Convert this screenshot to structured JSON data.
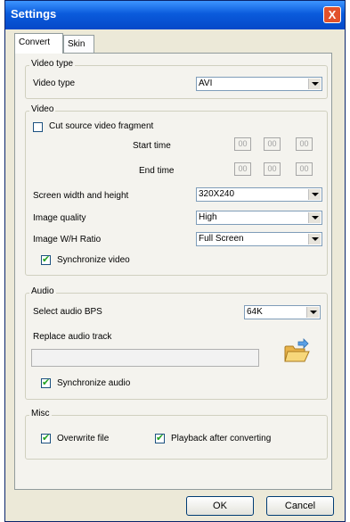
{
  "window": {
    "title": "Settings",
    "close": "X"
  },
  "tabs": [
    {
      "label": "Convert"
    },
    {
      "label": "Skin"
    }
  ],
  "video_type": {
    "group_label": "Video type",
    "label": "Video type",
    "value": "AVI"
  },
  "video": {
    "group_label": "Video",
    "cut_fragment_label": "Cut source video fragment",
    "cut_fragment_checked": false,
    "start_time_label": "Start time",
    "end_time_label": "End time",
    "start_time": [
      "00",
      "00",
      "00"
    ],
    "end_time": [
      "00",
      "00",
      "00"
    ],
    "screen_size_label": "Screen width and height",
    "screen_size_value": "320X240",
    "quality_label": "Image quality",
    "quality_value": "High",
    "ratio_label": "Image W/H Ratio",
    "ratio_value": "Full Screen",
    "sync_label": "Synchronize video",
    "sync_checked": true
  },
  "audio": {
    "group_label": "Audio",
    "bps_label": "Select audio BPS",
    "bps_value": "64K",
    "replace_label": "Replace audio track",
    "track_path": "",
    "sync_label": "Synchronize audio",
    "sync_checked": true
  },
  "misc": {
    "group_label": "Misc",
    "overwrite_label": "Overwrite file",
    "overwrite_checked": true,
    "playback_label": "Playback after converting",
    "playback_checked": true
  },
  "buttons": {
    "ok": "OK",
    "cancel": "Cancel"
  },
  "icons": {
    "browse": "folder-open-icon",
    "close": "close-icon",
    "check": "checkmark-icon"
  }
}
